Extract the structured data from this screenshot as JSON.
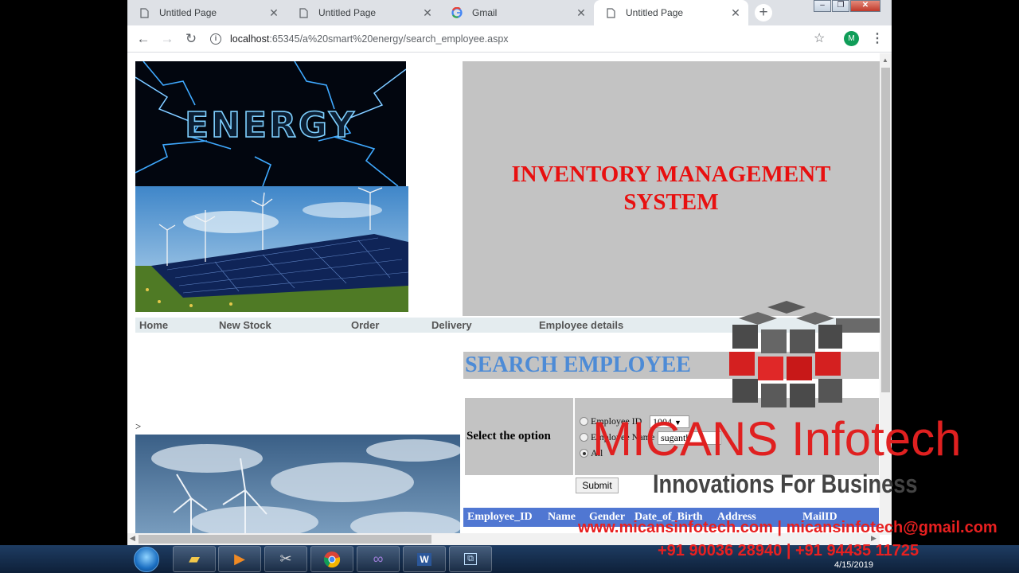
{
  "browser": {
    "tabs": [
      {
        "title": "Untitled Page",
        "icon": "page-icon",
        "active": false
      },
      {
        "title": "Untitled Page",
        "icon": "page-icon",
        "active": false
      },
      {
        "title": "Gmail",
        "icon": "google-icon",
        "active": false
      },
      {
        "title": "Untitled Page",
        "icon": "page-icon",
        "active": true
      }
    ],
    "url_host": "localhost",
    "url_rest": ":65345/a%20smart%20energy/search_employee.aspx",
    "profile_initial": "M"
  },
  "page": {
    "energy_image_text": "ENERGY",
    "header_title": "INVENTORY MANAGEMENT SYSTEM",
    "nav": [
      "Home",
      "New Stock",
      "Order",
      "Delivery",
      "Employee details"
    ],
    "search_title": "SEARCH EMPLOYEE",
    "gt_mark": ">",
    "select_label": "Select the option",
    "options": [
      {
        "label": "Employee ID",
        "selected": false
      },
      {
        "label": "Employee Name",
        "selected": false
      },
      {
        "label": "All",
        "selected": true
      }
    ],
    "employee_id_value": "1004",
    "employee_name_value": "suganth",
    "submit_label": "Submit",
    "grid_columns": [
      "Employee_ID",
      "Name",
      "Gender",
      "Date_of_Birth",
      "Address",
      "MailID"
    ]
  },
  "watermark": {
    "brand": "MICANS Infotech",
    "tagline": "Innovations For Business",
    "web_email": "www.micansinfotech.com | micansinfotech@gmail.com",
    "phones": "+91 90036 28940 | +91 94435 11725"
  },
  "taskbar": {
    "date": "4/15/2019"
  },
  "colors": {
    "header_title": "#e81010",
    "search_title": "#4d8bd6",
    "grid_header": "#5077d2",
    "panel_gray": "#c3c3c3",
    "watermark_red": "#e02020"
  }
}
